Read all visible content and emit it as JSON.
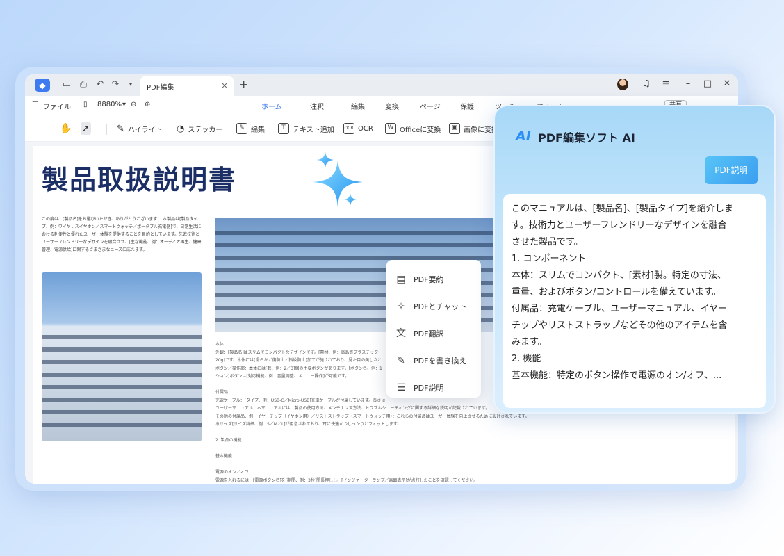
{
  "tabbar": {
    "tab_label": "PDF編集",
    "close_glyph": "×",
    "new_tab_glyph": "+"
  },
  "menubar": {
    "file_label": "ファイル",
    "zoom": "8880%",
    "tabs": [
      "ホーム",
      "注釈",
      "編集",
      "変換",
      "ページ",
      "保護",
      "ツール",
      "フォーム"
    ],
    "active_tab": "ホーム",
    "share_label": "共有"
  },
  "toolbar": {
    "highlight": "ハイライト",
    "sticker": "ステッカー",
    "edit": "編集",
    "add_text": "テキスト追加",
    "ocr": "OCR",
    "to_office": "Officeに変換",
    "to_image": "画像に変換"
  },
  "document": {
    "title": "製品取扱説明書",
    "intro": "この度は、[製品名]をお選びいただき、ありがとうございます！ 本製品は[製品タイプ、例：ワイヤレスイヤホン／スマートウォッチ／ポータブル充電器]で、日常生活における利便性と優れたユーザー体験を提供することを目的としています。先進技術とユーザーフレンドリーなデザインを融合させ、[主な機能、例：オーディオ再生、健康管理、電源供給]に関するさまざまなニーズに応えます。",
    "body_lines": [
      "本体",
      "外観：[製品名]はスリムでコンパクトなデザインです。[素材、例：高品質プラスチック",
      "20g]です。本体には[滑らか／傷防止／指紋防止]加工が施されており、見た目の美しさと",
      "ボタン／操作部：本体には[数、例：2／3]個の主要ボタンがあります。[ボタン名、例：1",
      "ション]ボタンは[対応機能、例：音量調整、メニュー操作]が可能です。",
      "",
      "付属品",
      "充電ケーブル：[タイプ、例：USB-C／Micro-USB]充電ケーブルが付属しています。長さは",
      "ユーザーマニュアル：本マニュアルには、製品の使用方法、メンテナンス方法、トラブルシューティングに関する詳細な説明が記載されています。",
      "その他の付属品、例：イヤーチップ（イヤホン用）／リストストラップ（スマートウォッチ用）：これらの付属品はユーザー体験を向上させるために設計されています。",
      "るサイズ[サイズ詳細、例：S／M／L]が用意されており、耳に快適かつしっかりとフィットします。",
      "",
      "2. 製品の機能",
      "",
      "基本機能",
      "",
      "電源のオン／オフ：",
      "電源を入れるには：[電源ボタン名]を[期間、例：3秒]間長押しし、[インジケーターランプ／画面表示]が点灯したことを確認してください。"
    ]
  },
  "ai_menu": {
    "items": [
      {
        "label": "PDF要約",
        "icon": "summary-icon"
      },
      {
        "label": "PDFとチャット",
        "icon": "sparkle-chat-icon"
      },
      {
        "label": "PDF翻訳",
        "icon": "translate-icon"
      },
      {
        "label": "PDFを書き換え",
        "icon": "rewrite-wand-icon"
      },
      {
        "label": "PDF説明",
        "icon": "explain-icon"
      }
    ]
  },
  "ai_panel": {
    "logo": "AI",
    "title": "PDF編集ソフト AI",
    "prompt_button": "PDF説明",
    "answer": [
      "このマニュアルは、[製品名]、[製品タイプ]を紹介しま",
      "す。技術力とユーザーフレンドリーなデザインを融合",
      "させた製品です。",
      "1. コンポーネント",
      "本体：スリムでコンパクト、[素材]製。特定の寸法、",
      "重量、およびボタン/コントロールを備えています。",
      "付属品：充電ケーブル、ユーザーマニュアル、イヤー",
      "チップやリストストラップなどその他のアイテムを含",
      "みます。",
      "2. 機能",
      "基本機能：特定のボタン操作で電源のオン/オフ、..."
    ]
  },
  "colors": {
    "accent": "#2f6fec",
    "title_navy": "#1b2f66",
    "ai_blue": "#2b8ef2"
  }
}
